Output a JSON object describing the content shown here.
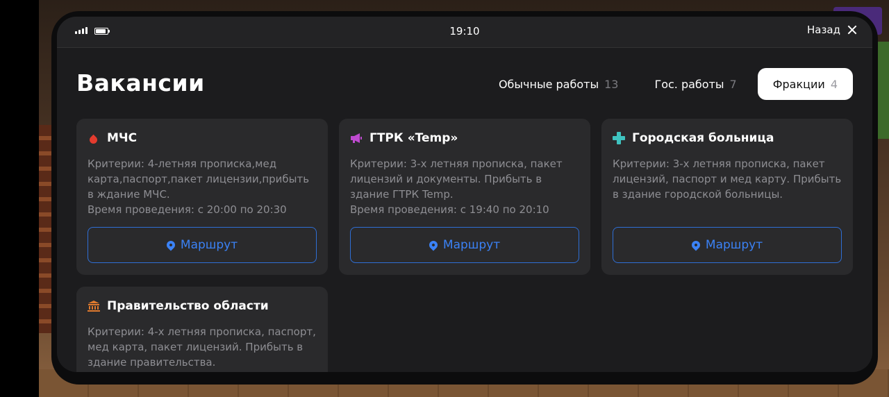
{
  "statusbar": {
    "time": "19:10",
    "back_label": "Назад"
  },
  "page": {
    "title": "Вакансии"
  },
  "tabs": [
    {
      "label": "Обычные работы",
      "count": "13",
      "active": false
    },
    {
      "label": "Гос. работы",
      "count": "7",
      "active": false
    },
    {
      "label": "Фракции",
      "count": "4",
      "active": true
    }
  ],
  "cards": [
    {
      "icon": "fire-drop-icon",
      "title": "МЧС",
      "criteria": "Критерии: 4-летняя прописка,мед карта,паспорт,пакет лицензии,прибыть в ждание МЧС.",
      "time": "Время проведения: с 20:00 по 20:30",
      "button": "Маршрут"
    },
    {
      "icon": "megaphone-icon",
      "title": "ГТРК «Temp»",
      "criteria": "Критерии: 3-х летняя прописка, пакет лицензий и документы. Прибыть в здание ГТРК Temp.",
      "time": "Время проведения: с 19:40 по 20:10",
      "button": "Маршрут"
    },
    {
      "icon": "medical-cross-icon",
      "title": "Городская больница",
      "criteria": "Критерии: 3-х летняя прописка, пакет лицензий, паспорт и мед карту. Прибыть в здание городской больницы.",
      "time": "",
      "button": "Маршрут"
    },
    {
      "icon": "government-building-icon",
      "title": "Правительство области",
      "criteria": "Критерии: 4-х летняя прописка, паспорт, мед карта, пакет лицензий. Прибыть в здание правительства.",
      "time": "",
      "button": ""
    }
  ],
  "colors": {
    "accent": "#3b82f6",
    "panel": "#1c1c1e",
    "card": "#2a2a2c",
    "muted_text": "#8e8e93"
  }
}
